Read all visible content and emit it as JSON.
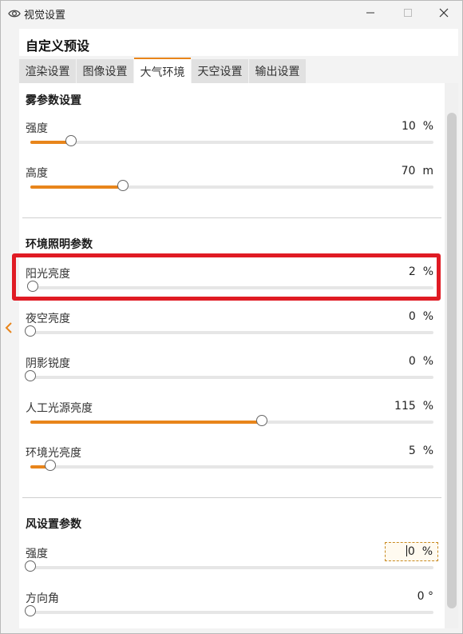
{
  "window": {
    "title": "视觉设置",
    "icon": "eye-icon",
    "controls": [
      "minimize-icon",
      "maximize-icon",
      "close-icon"
    ]
  },
  "preset": {
    "title": "自定义预设"
  },
  "tabs": [
    {
      "label": "渲染设置",
      "active": false
    },
    {
      "label": "图像设置",
      "active": false
    },
    {
      "label": "大气环境",
      "active": true
    },
    {
      "label": "天空设置",
      "active": false
    },
    {
      "label": "输出设置",
      "active": false
    }
  ],
  "sections": {
    "fog": {
      "title": "雾参数设置",
      "params": [
        {
          "label": "强度",
          "value": "10",
          "unit": "%",
          "fraction": 0.1
        },
        {
          "label": "高度",
          "value": "70",
          "unit": "m",
          "fraction": 0.23
        }
      ]
    },
    "ambient": {
      "title": "环境照明参数",
      "params": [
        {
          "label": "阳光亮度",
          "value": "2",
          "unit": "%",
          "fraction": 0.005
        },
        {
          "label": "夜空亮度",
          "value": "0",
          "unit": "%",
          "fraction": 0.0
        },
        {
          "label": "阴影锐度",
          "value": "0",
          "unit": "%",
          "fraction": 0.0
        },
        {
          "label": "人工光源亮度",
          "value": "115",
          "unit": "%",
          "fraction": 0.575
        },
        {
          "label": "环境光亮度",
          "value": "5",
          "unit": "%",
          "fraction": 0.05
        }
      ]
    },
    "wind": {
      "title": "风设置参数",
      "params": [
        {
          "label": "强度",
          "value": "0",
          "unit": "%",
          "fraction": 0.0
        },
        {
          "label": "方向角",
          "value": "0",
          "unit": "°",
          "fraction": 0.0
        }
      ]
    }
  },
  "colors": {
    "accent": "#e8851b",
    "highlight": "#e01b24"
  }
}
